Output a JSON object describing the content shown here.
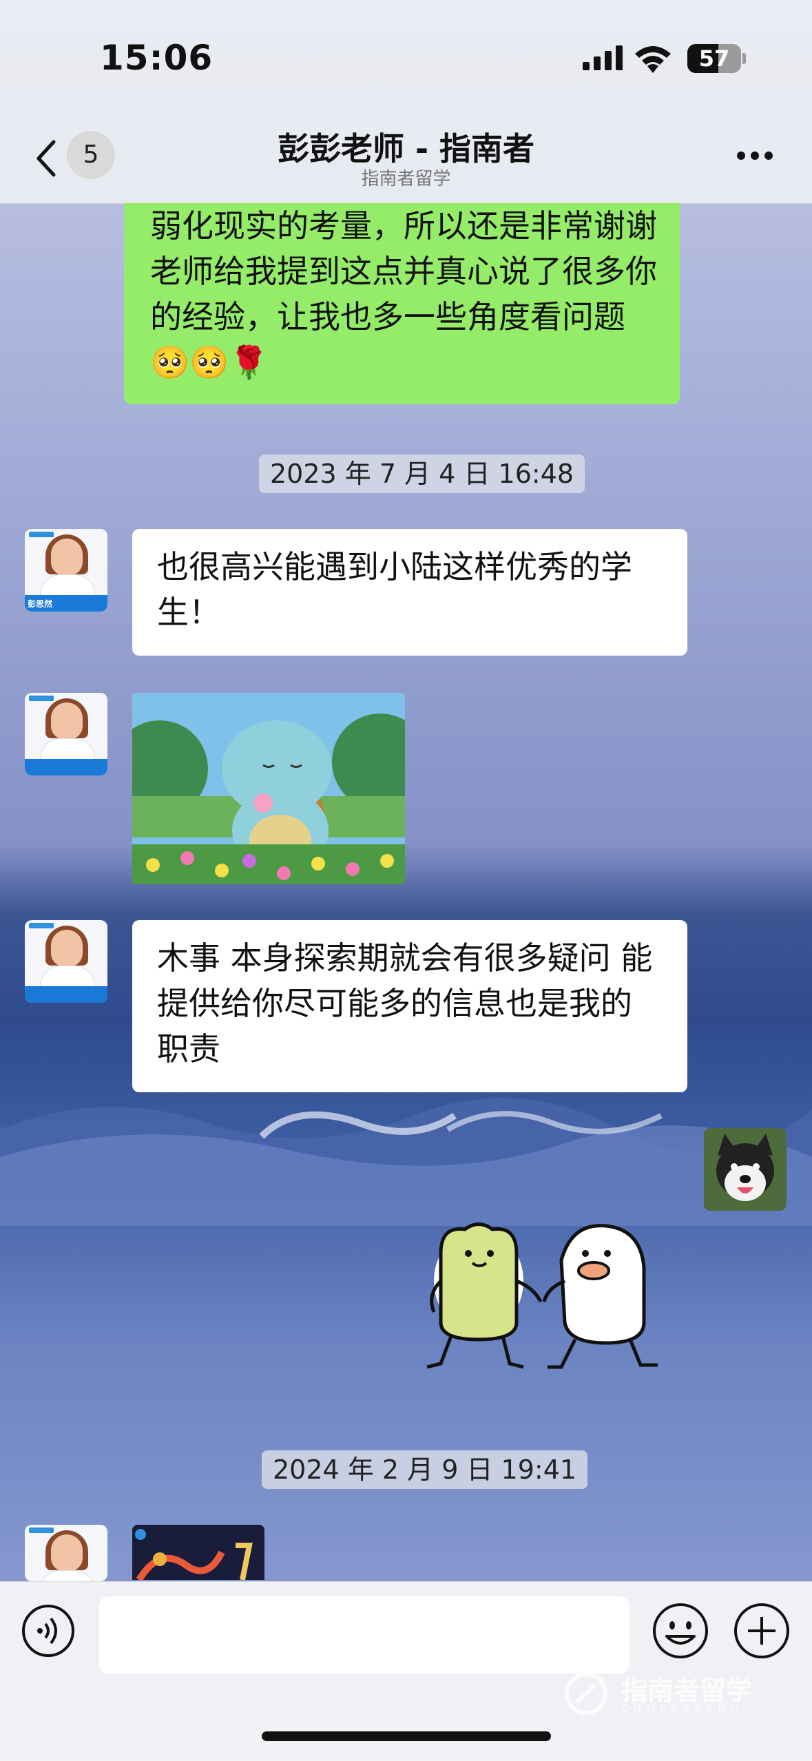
{
  "status_bar": {
    "time": "15:06",
    "battery": "57"
  },
  "nav": {
    "back_count": "5",
    "title": "彭彭老师 - 指南者",
    "subtitle": "指南者留学"
  },
  "messages": {
    "self_partial": {
      "text": "弱化现实的考量，所以还是非常谢谢老师给我提到这点并真心说了很多你的经验，让我也多一些角度看问题",
      "emojis": "🥺🥺🌹"
    },
    "timestamp_1": "2023 年 7 月 4 日 16:48",
    "reply_1": "也很高兴能遇到小陆这样优秀的学生！",
    "reply_2": "木事 本身探索期就会有很多疑问 能提供给你尽可能多的信息也是我的职责",
    "timestamp_2": "2024 年 2 月 9 日 19:41",
    "avatar_name": "彭思然"
  },
  "input": {
    "placeholder": ""
  },
  "watermark": {
    "text": "指南者留学",
    "sub": "COMPASSEDU"
  },
  "colors": {
    "self_bubble": "#95ec69",
    "incoming_bubble": "#ffffff",
    "bar": "#eceef2"
  },
  "icons": [
    "back-chevron-icon",
    "more-icon",
    "voice-icon",
    "emoji-icon",
    "plus-icon",
    "signal-icon",
    "wifi-icon",
    "battery-icon"
  ]
}
